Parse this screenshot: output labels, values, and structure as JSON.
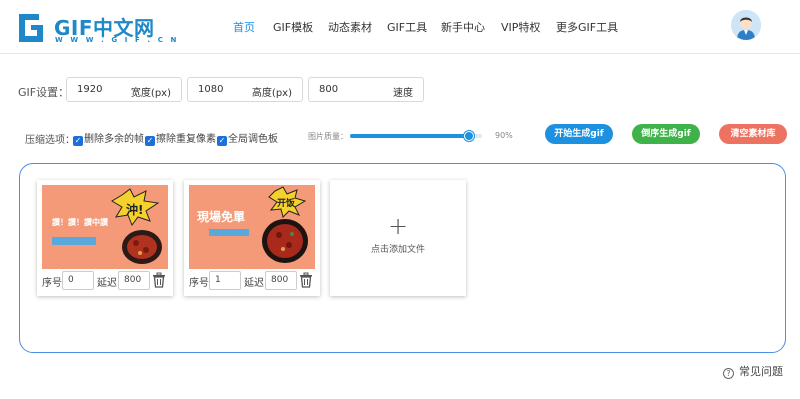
{
  "header": {
    "logo_text": "GIF中文网",
    "logo_sub": "W W W . G I F . C N",
    "nav": [
      {
        "label": "首页"
      },
      {
        "label": "GIF模板"
      },
      {
        "label": "动态素材"
      },
      {
        "label": "GIF工具"
      },
      {
        "label": "新手中心"
      },
      {
        "label": "VIP特权"
      },
      {
        "label": "更多GIF工具"
      }
    ]
  },
  "settings": {
    "label": "GIF设置：",
    "width": {
      "value": "1920",
      "unit": "宽度(px)"
    },
    "height": {
      "value": "1080",
      "unit": "高度(px)"
    },
    "speed": {
      "value": "800",
      "unit": "速度"
    }
  },
  "options": {
    "label": "压缩选项：",
    "checks": [
      "删除多余的帧",
      "擦除重复像素",
      "全局调色板"
    ],
    "quality_label": "图片质量：",
    "quality_value": "90%",
    "quality_fraction": 0.9
  },
  "buttons": {
    "start": "开始生成gif",
    "reverse": "倒序生成gif",
    "clear": "清空素材库"
  },
  "colors": {
    "start": "#1e90e0",
    "reverse": "#3fb24a",
    "clear": "#ee7261"
  },
  "frames": [
    {
      "thumb_text": "沖!",
      "banner": "讚！讚！讚中讚",
      "seq_label": "序号",
      "seq_value": "0",
      "delay_label": "延迟",
      "delay_value": "800"
    },
    {
      "thumb_text": "开饭",
      "banner": "現場免單",
      "seq_label": "序号",
      "seq_value": "1",
      "delay_label": "延迟",
      "delay_value": "800"
    }
  ],
  "add_card": {
    "label": "点击添加文件"
  },
  "faq": {
    "label": "常见问题"
  }
}
